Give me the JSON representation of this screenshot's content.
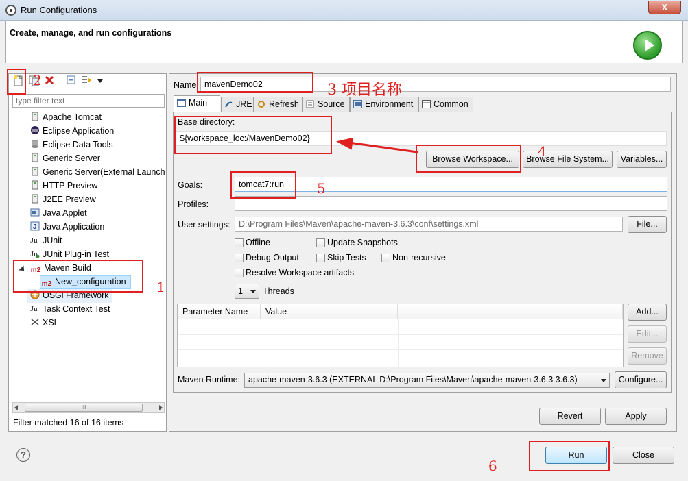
{
  "window": {
    "title": "Run Configurations",
    "close_symbol": "X"
  },
  "header": {
    "title": "Create, manage, and run configurations"
  },
  "toolbar": {
    "icons": [
      "new-launch-configuration-icon",
      "duplicate-icon",
      "delete-icon",
      "collapse-all-icon",
      "filter-icon",
      "dropdown-arrow-icon"
    ]
  },
  "filter": {
    "placeholder": "type filter text"
  },
  "tree": {
    "items": [
      {
        "label": "Apache Tomcat",
        "icon": "tomcat-icon"
      },
      {
        "label": "Eclipse Application",
        "icon": "eclipse-icon"
      },
      {
        "label": "Eclipse Data Tools",
        "icon": "database-icon"
      },
      {
        "label": "Generic Server",
        "icon": "server-icon"
      },
      {
        "label": "Generic Server(External Launch",
        "icon": "server-icon"
      },
      {
        "label": "HTTP Preview",
        "icon": "server-icon"
      },
      {
        "label": "J2EE Preview",
        "icon": "server-icon"
      },
      {
        "label": "Java Applet",
        "icon": "applet-icon"
      },
      {
        "label": "Java Application",
        "icon": "java-app-icon"
      },
      {
        "label": "JUnit",
        "icon": "junit-icon"
      },
      {
        "label": "JUnit Plug-in Test",
        "icon": "junit-plugin-icon"
      },
      {
        "label": "Maven Build",
        "icon": "maven-icon",
        "expanded": true
      },
      {
        "label": "New_configuration",
        "icon": "maven-icon",
        "child": true,
        "selected": true
      },
      {
        "label": "OSGi Framework",
        "icon": "osgi-icon"
      },
      {
        "label": "Task Context Test",
        "icon": "task-icon"
      },
      {
        "label": "XSL",
        "icon": "xsl-icon"
      }
    ],
    "m2": "m2"
  },
  "scroll_grip": "III",
  "status": {
    "filter_matched": "Filter matched 16 of 16 items"
  },
  "form": {
    "name_label": "Name:",
    "name_value": "mavenDemo02",
    "tabs": [
      "Main",
      "JRE",
      "Refresh",
      "Source",
      "Environment",
      "Common"
    ],
    "base_dir_label": "Base directory:",
    "base_dir_value": "${workspace_loc:/MavenDemo02}",
    "browse_workspace": "Browse Workspace...",
    "browse_fs": "Browse File System...",
    "variables": "Variables...",
    "goals_label": "Goals:",
    "goals_value": "tomcat7:run",
    "profiles_label": "Profiles:",
    "profiles_value": "",
    "user_settings_label": "User settings:",
    "user_settings_value": "D:\\Program Files\\Maven\\apache-maven-3.6.3\\conf\\settings.xml",
    "file_button": "File...",
    "checkboxes": {
      "offline": "Offline",
      "update_snapshots": "Update Snapshots",
      "debug_output": "Debug Output",
      "skip_tests": "Skip Tests",
      "non_recursive": "Non-recursive",
      "resolve_workspace": "Resolve Workspace artifacts"
    },
    "threads_value": "1",
    "threads_label": "Threads",
    "param_headers": [
      "Parameter Name",
      "Value"
    ],
    "add": "Add...",
    "edit": "Edit...",
    "remove": "Remove",
    "runtime_label": "Maven Runtime:",
    "runtime_value": "apache-maven-3.6.3 (EXTERNAL D:\\Program Files\\Maven\\apache-maven-3.6.3 3.6.3)",
    "configure": "Configure...",
    "revert": "Revert",
    "apply": "Apply"
  },
  "footer": {
    "run": "Run",
    "close": "Close",
    "help": "?"
  },
  "annotations": {
    "n1": "1",
    "n2": "2",
    "n3": "3 项目名称",
    "n4": "4",
    "n5": "5",
    "n6": "6"
  },
  "colors": {
    "annotation": "#e02020",
    "selection": "#cce8ff",
    "run_green": "#2d9c2a"
  }
}
